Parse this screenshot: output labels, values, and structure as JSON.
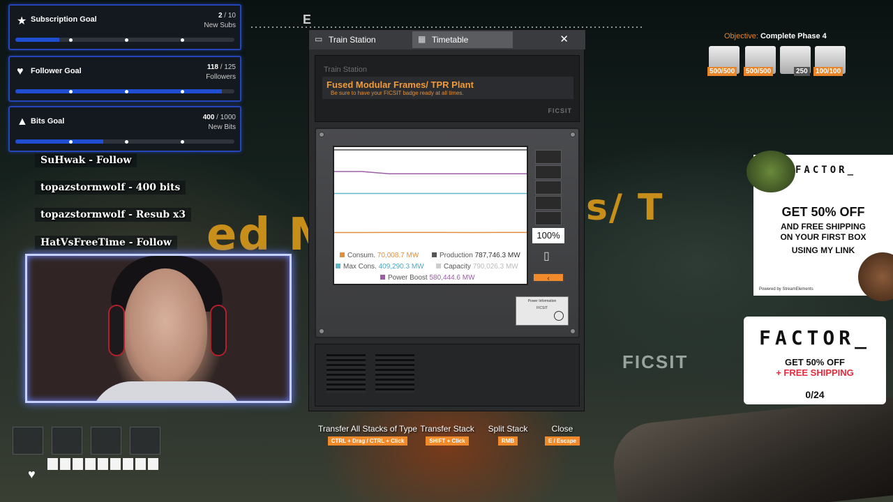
{
  "goals": [
    {
      "title": "Subscription Goal",
      "current": "2",
      "target": "10",
      "unit": "New Subs",
      "progress": 0.2,
      "icon": "star-icon"
    },
    {
      "title": "Follower Goal",
      "current": "118",
      "target": "125",
      "unit": "Followers",
      "progress": 0.944,
      "icon": "heart-icon"
    },
    {
      "title": "Bits Goal",
      "current": "400",
      "target": "1000",
      "unit": "New Bits",
      "progress": 0.4,
      "icon": "bits-triangle-icon"
    }
  ],
  "feed": [
    "SuHwak - Follow",
    "topazstormwolf - 400 bits",
    "topazstormwolf - Resub x3",
    "HatVsFreeTime - Follow"
  ],
  "compass": {
    "heading": "E"
  },
  "tabs": {
    "train_station": "Train Station",
    "timetable": "Timetable",
    "close": "✕"
  },
  "station": {
    "label": "Train Station",
    "name": "Fused Modular Frames/ TPR Plant",
    "subtitle": "Be sure to have your FICSIT badge ready at all times.",
    "brand": "FICSIT"
  },
  "power": {
    "battery_pct": "100%",
    "battery_level": 1.0,
    "collapse": "‹",
    "legend": {
      "consumption_label": "Consum.",
      "consumption_value": "70,008.7 MW",
      "production_label": "Production",
      "production_value": "787,746.3 MW",
      "max_label": "Max Cons.",
      "max_value": "409,290.3 MW",
      "capacity_label": "Capacity",
      "capacity_value": "790,026.3 MW",
      "boost_label": "Power Boost",
      "boost_value": "580,444.6 MW"
    },
    "colors": {
      "consumption": "#e0903c",
      "production": "#555555",
      "max": "#5fb7c8",
      "capacity": "#cccccc",
      "boost": "#9b5fa6"
    }
  },
  "chart_data": {
    "type": "line",
    "title": "",
    "xlabel": "",
    "ylabel": "",
    "ylim": [
      0,
      800000
    ],
    "series": [
      {
        "name": "Capacity",
        "values": [
          790026.3,
          790026.3,
          790026.3,
          790026.3,
          790026.3,
          790026.3,
          790026.3,
          790026.3
        ]
      },
      {
        "name": "Production",
        "values": [
          787746.3,
          787746.3,
          787746.3,
          787746.3,
          787746.3,
          787746.3,
          787746.3,
          787746.3
        ]
      },
      {
        "name": "Power Boost",
        "values": [
          600000,
          600000,
          580444.6,
          580444.6,
          580444.6,
          580444.6,
          580444.6,
          580444.6
        ]
      },
      {
        "name": "Max Cons.",
        "values": [
          409290.3,
          409290.3,
          409290.3,
          409290.3,
          409290.3,
          409290.3,
          409290.3,
          409290.3
        ]
      },
      {
        "name": "Consum.",
        "values": [
          70000,
          69500,
          70200,
          70008.7,
          70300,
          69800,
          70100,
          70008.7
        ]
      }
    ]
  },
  "info_card": {
    "title": "Power Information",
    "line": "FICSIT"
  },
  "actions": [
    {
      "label": "Transfer All Stacks of Type",
      "key": "CTRL + Drag / CTRL + Click"
    },
    {
      "label": "Transfer Stack",
      "key": "SHIFT + Click"
    },
    {
      "label": "Split Stack",
      "key": "RMB"
    },
    {
      "label": "Close",
      "key": "E / Escape"
    }
  ],
  "objective": {
    "prefix": "Objective:",
    "text": "Complete Phase 4",
    "items": [
      "500/500",
      "500/500",
      "250",
      "100/100"
    ]
  },
  "ad1": {
    "brand": "FACTOR_",
    "headline": "GET 50% OFF",
    "line1": "AND FREE SHIPPING",
    "line2": "ON YOUR FIRST BOX",
    "line3": "USING MY LINK",
    "powered": "Powered by StreamElements"
  },
  "ad2": {
    "brand": "FACTOR_",
    "line1": "GET 50% OFF",
    "line2": "+ FREE SHIPPING",
    "count": "0/24"
  },
  "bg": {
    "sign": "ed Mo",
    "sign2": "s/ T",
    "ficsit": "FICSIT"
  }
}
